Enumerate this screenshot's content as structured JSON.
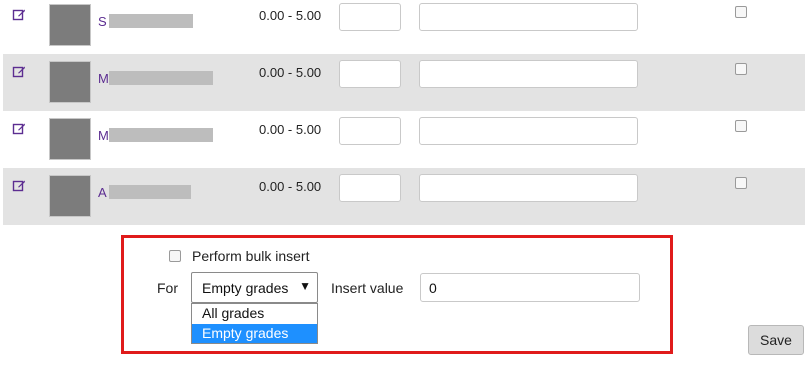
{
  "colors": {
    "highlight_border": "#e01b1b",
    "selected_option": "#1e90ff",
    "link": "#5c2d91",
    "row_alt": "#e3e3e3"
  },
  "icons": {
    "edit": "edit-icon"
  },
  "rows": [
    {
      "initial": "S",
      "range": "0.00 - 5.00",
      "grade": "",
      "feedback": ""
    },
    {
      "initial": "M",
      "range": "0.00 - 5.00",
      "grade": "",
      "feedback": ""
    },
    {
      "initial": "M",
      "range": "0.00 - 5.00",
      "grade": "",
      "feedback": ""
    },
    {
      "initial": "A",
      "range": "0.00 - 5.00",
      "grade": "",
      "feedback": ""
    }
  ],
  "bulk": {
    "checkbox_label": "Perform bulk insert",
    "for_label": "For",
    "selected": "Empty grades",
    "options": [
      "All grades",
      "Empty grades"
    ],
    "insert_label": "Insert value",
    "insert_value": "0"
  },
  "save_label": "Save"
}
